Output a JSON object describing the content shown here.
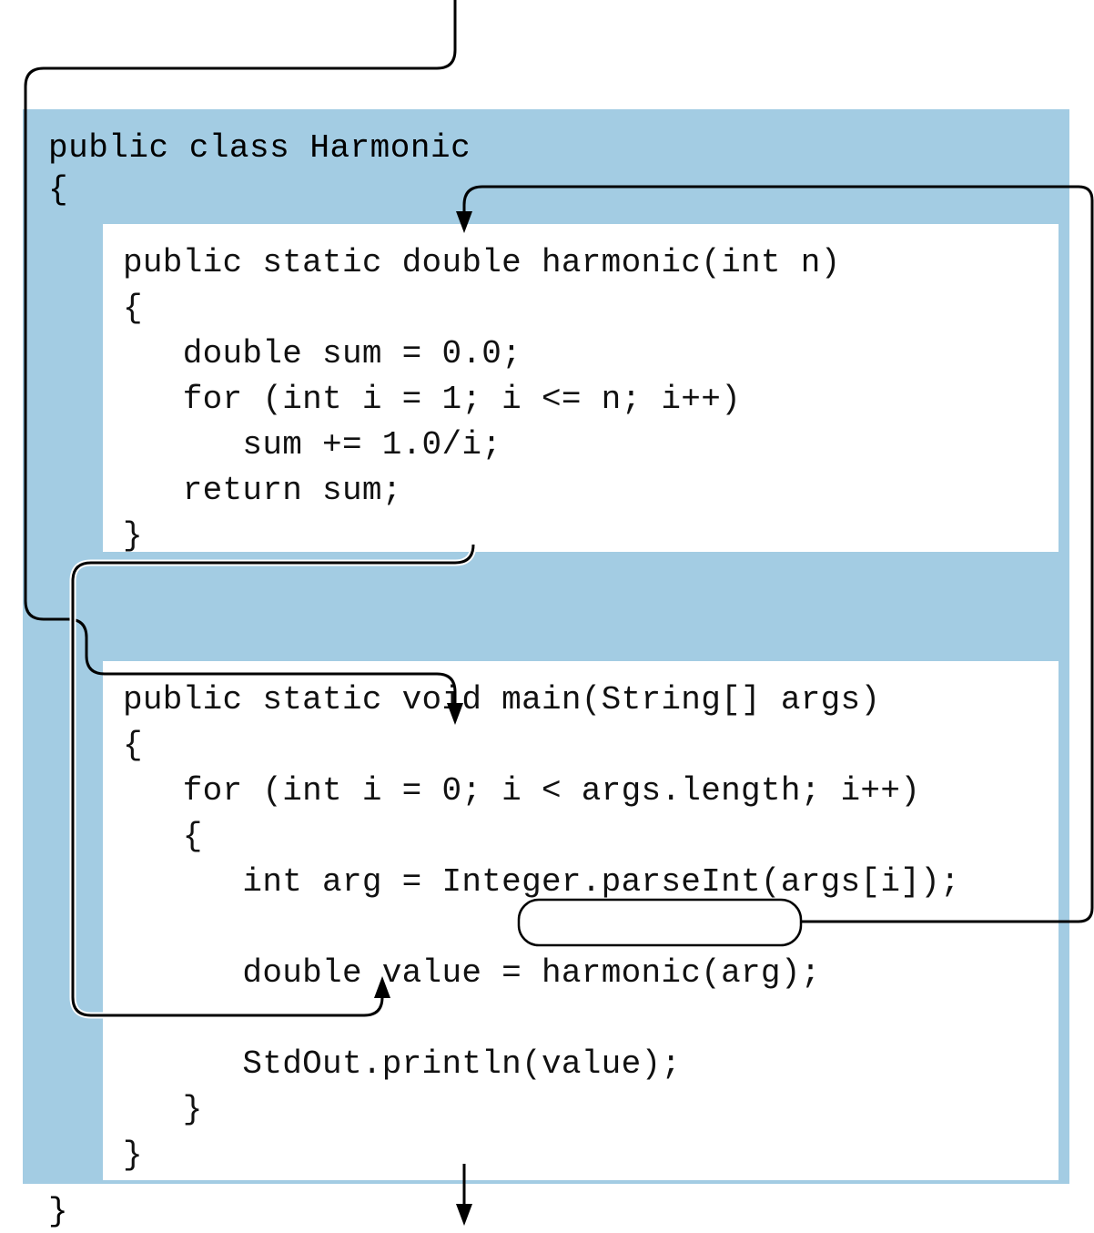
{
  "class": {
    "decl_line1": "public class Harmonic",
    "decl_line2": "{",
    "close": "}"
  },
  "harmonic": {
    "sig": "public static double harmonic(int n)",
    "open": "{",
    "l1": "   double sum = 0.0;",
    "l2": "   for (int i = 1; i <= n; i++)",
    "l3": "      sum += 1.0/i;",
    "l4": "   return sum;",
    "close": "}"
  },
  "main": {
    "sig": "public static void main(String[] args)",
    "open": "{",
    "l1": "   for (int i = 0; i < args.length; i++)",
    "l2": "   {",
    "l3": "      int arg = Integer.parseInt(args[i]);",
    "blank1": "",
    "l4a": "      double value = ",
    "l4b": "harmonic(arg);",
    "blank2": "",
    "l5": "      StdOut.println(value);",
    "l6": "   }",
    "close": "}"
  }
}
